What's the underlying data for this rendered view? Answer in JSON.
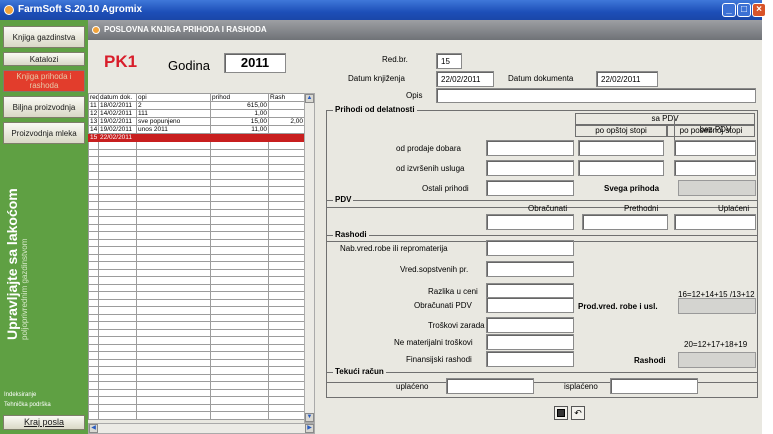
{
  "app": {
    "title": "FarmSoft S.20.10 Agromix"
  },
  "sidebar": {
    "items": [
      {
        "label": "Knjiga gazdinstva"
      },
      {
        "label": "Katalozi"
      },
      {
        "label": "Knjiga prihoda i rashoda"
      },
      {
        "label": "Biljna proizvodnja"
      },
      {
        "label": "Proizvodnja mleka"
      }
    ],
    "tagline": "Upravljajte sa lakoćom",
    "tagline_sub": "poljoprivrednim gazdinstvom",
    "bottom": [
      {
        "label": "Indeksiranje"
      },
      {
        "label": "Tehnička podrška"
      },
      {
        "label": "Kraj posla"
      }
    ]
  },
  "panel": {
    "title": "POSLOVNA KNJIGA PRIHODA I RASHODA"
  },
  "book": {
    "code": "PK1",
    "year_label": "Godina",
    "year": "2011"
  },
  "table": {
    "columns": [
      "red",
      "datum dok.",
      "opi",
      "prihod",
      "Rash"
    ],
    "rows": [
      [
        "11",
        "18/02/2011",
        "2",
        "615,00",
        ""
      ],
      [
        "12",
        "14/02/2011",
        "111",
        "1,00",
        ""
      ],
      [
        "13",
        "19/02/2011",
        "sve popunjeno",
        "15,00",
        "2,00"
      ],
      [
        "14",
        "19/02/2011",
        "unos 2011",
        "11,00",
        ""
      ],
      [
        "15",
        "22/02/2011",
        "",
        "",
        ""
      ]
    ],
    "selected_index": 4
  },
  "form": {
    "redbr_label": "Red.br.",
    "redbr": "15",
    "datum_knj_label": "Datum knjiženja",
    "datum_knj": "22/02/2011",
    "datum_dok_label": "Datum dokumenta",
    "datum_dok": "22/02/2011",
    "opis_label": "Opis",
    "opis": ""
  },
  "prihodi": {
    "title": "Prihodi od delatnosti",
    "sa_pdv": "sa PDV",
    "opsta": "po opštoj stopi",
    "posebna": "po posebnoj stopi",
    "bez_pdv": "bez PDV",
    "prodaja": "od prodaje dobara",
    "usluge": "od izvršenih usluga",
    "ostali": "Ostali prihodi",
    "svega": "Svega prihoda"
  },
  "pdv": {
    "title": "PDV",
    "obracunati": "Obračunati",
    "prethodni": "Prethodni",
    "uplaceni": "Uplaćeni"
  },
  "rashodi": {
    "title": "Rashodi",
    "nab": "Nab.vred.robe ili repromaterija",
    "vred": "Vred.sopstvenih pr.",
    "razlika": "Razlika u ceni",
    "obr_pdv": "Obračunati PDV",
    "formula1": "16=12+14+15 /13+12",
    "prodvred": "Prod.vred. robe i usl.",
    "troskovi": "Troškovi zarada",
    "nemat": "Ne materijalni troškovi",
    "fin": "Finansijski rashodi",
    "formula2": "20=12+17+18+19",
    "rashodi_lbl": "Rashodi"
  },
  "tekuci": {
    "title": "Tekući račun",
    "uplaceno": "uplaćeno",
    "isplaceno": "isplaćeno"
  },
  "icons": {
    "save": "floppy-disk-icon",
    "undo": "undo-arrow-icon"
  },
  "colors": {
    "sidebar": "#5fa043",
    "active": "#e23d2c",
    "selected_row": "#c81f1f",
    "title": "#d81d2a"
  }
}
